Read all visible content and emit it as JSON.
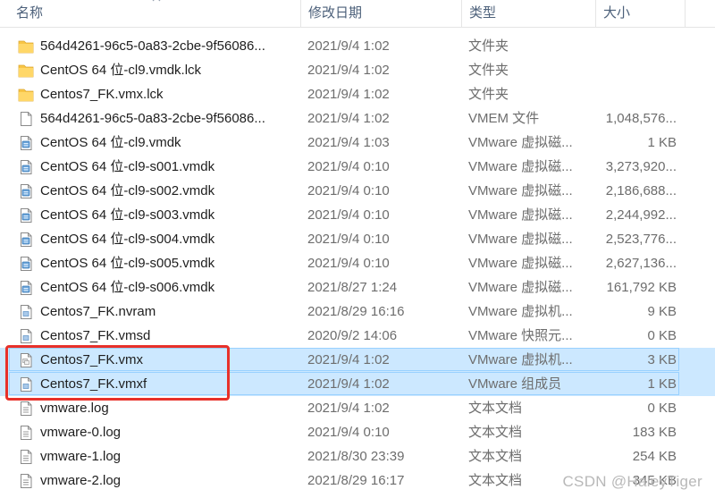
{
  "columns": {
    "name": "名称",
    "date": "修改日期",
    "type": "类型",
    "size": "大小"
  },
  "files": [
    {
      "name": "564d4261-96c5-0a83-2cbe-9f56086...",
      "date": "2021/9/4 1:02",
      "type": "文件夹",
      "size": "",
      "icon": "folder-icon",
      "selected": false
    },
    {
      "name": "CentOS 64 位-cl9.vmdk.lck",
      "date": "2021/9/4 1:02",
      "type": "文件夹",
      "size": "",
      "icon": "folder-icon",
      "selected": false
    },
    {
      "name": "Centos7_FK.vmx.lck",
      "date": "2021/9/4 1:02",
      "type": "文件夹",
      "size": "",
      "icon": "folder-icon",
      "selected": false
    },
    {
      "name": "564d4261-96c5-0a83-2cbe-9f56086...",
      "date": "2021/9/4 1:02",
      "type": "VMEM 文件",
      "size": "1,048,576...",
      "icon": "blank-file-icon",
      "selected": false
    },
    {
      "name": "CentOS 64 位-cl9.vmdk",
      "date": "2021/9/4 1:03",
      "type": "VMware 虚拟磁...",
      "size": "1 KB",
      "icon": "vmware-disk-icon",
      "selected": false
    },
    {
      "name": "CentOS 64 位-cl9-s001.vmdk",
      "date": "2021/9/4 0:10",
      "type": "VMware 虚拟磁...",
      "size": "3,273,920...",
      "icon": "vmware-disk-icon",
      "selected": false
    },
    {
      "name": "CentOS 64 位-cl9-s002.vmdk",
      "date": "2021/9/4 0:10",
      "type": "VMware 虚拟磁...",
      "size": "2,186,688...",
      "icon": "vmware-disk-icon",
      "selected": false
    },
    {
      "name": "CentOS 64 位-cl9-s003.vmdk",
      "date": "2021/9/4 0:10",
      "type": "VMware 虚拟磁...",
      "size": "2,244,992...",
      "icon": "vmware-disk-icon",
      "selected": false
    },
    {
      "name": "CentOS 64 位-cl9-s004.vmdk",
      "date": "2021/9/4 0:10",
      "type": "VMware 虚拟磁...",
      "size": "2,523,776...",
      "icon": "vmware-disk-icon",
      "selected": false
    },
    {
      "name": "CentOS 64 位-cl9-s005.vmdk",
      "date": "2021/9/4 0:10",
      "type": "VMware 虚拟磁...",
      "size": "2,627,136...",
      "icon": "vmware-disk-icon",
      "selected": false
    },
    {
      "name": "CentOS 64 位-cl9-s006.vmdk",
      "date": "2021/8/27 1:24",
      "type": "VMware 虚拟磁...",
      "size": "161,792 KB",
      "icon": "vmware-disk-icon",
      "selected": false
    },
    {
      "name": "Centos7_FK.nvram",
      "date": "2021/8/29 16:16",
      "type": "VMware 虚拟机...",
      "size": "9 KB",
      "icon": "vmware-file-icon",
      "selected": false
    },
    {
      "name": "Centos7_FK.vmsd",
      "date": "2020/9/2 14:06",
      "type": "VMware 快照元...",
      "size": "0 KB",
      "icon": "vmware-file-icon",
      "selected": false
    },
    {
      "name": "Centos7_FK.vmx",
      "date": "2021/9/4 1:02",
      "type": "VMware 虚拟机...",
      "size": "3 KB",
      "icon": "vmware-vm-icon",
      "selected": true
    },
    {
      "name": "Centos7_FK.vmxf",
      "date": "2021/9/4 1:02",
      "type": "VMware 组成员",
      "size": "1 KB",
      "icon": "vmware-file-icon",
      "selected": true
    },
    {
      "name": "vmware.log",
      "date": "2021/9/4 1:02",
      "type": "文本文档",
      "size": "0 KB",
      "icon": "text-file-icon",
      "selected": false
    },
    {
      "name": "vmware-0.log",
      "date": "2021/9/4 0:10",
      "type": "文本文档",
      "size": "183 KB",
      "icon": "text-file-icon",
      "selected": false
    },
    {
      "name": "vmware-1.log",
      "date": "2021/8/30 23:39",
      "type": "文本文档",
      "size": "254 KB",
      "icon": "text-file-icon",
      "selected": false
    },
    {
      "name": "vmware-2.log",
      "date": "2021/8/29 16:17",
      "type": "文本文档",
      "size": "345 KB",
      "icon": "text-file-icon",
      "selected": false
    }
  ],
  "colors": {
    "selection": "#cce8ff",
    "selection_border": "#99d1ff",
    "highlight_box": "#e8312a",
    "folder": "#f8c545"
  },
  "watermark": "CSDN @HaleyTiger"
}
